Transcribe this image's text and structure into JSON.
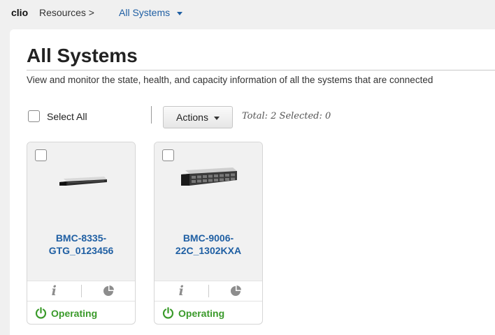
{
  "breadcrumb": {
    "brand": "clio",
    "resources": "Resources >",
    "current": "All Systems"
  },
  "page": {
    "title": "All Systems",
    "description": "View and monitor the state, health, and capacity information of all the systems that are connected"
  },
  "toolbar": {
    "select_all_label": "Select All",
    "actions_label": "Actions",
    "totals_text": "Total: 2 Selected: 0"
  },
  "systems": [
    {
      "name_line1": "BMC-8335-",
      "name_line2": "GTG_0123456",
      "status": "Operating",
      "info_icon": "i"
    },
    {
      "name_line1": "BMC-9006-",
      "name_line2": "22C_1302KXA",
      "status": "Operating",
      "info_icon": "i"
    }
  ],
  "colors": {
    "link": "#1f5fa3",
    "status_ok": "#3a9a2a",
    "icon_gray": "#8d8d8d"
  },
  "icons": [
    "caret-down-icon",
    "info-icon",
    "pie-chart-icon",
    "power-icon",
    "server-1u-icon",
    "server-2u-icon"
  ]
}
